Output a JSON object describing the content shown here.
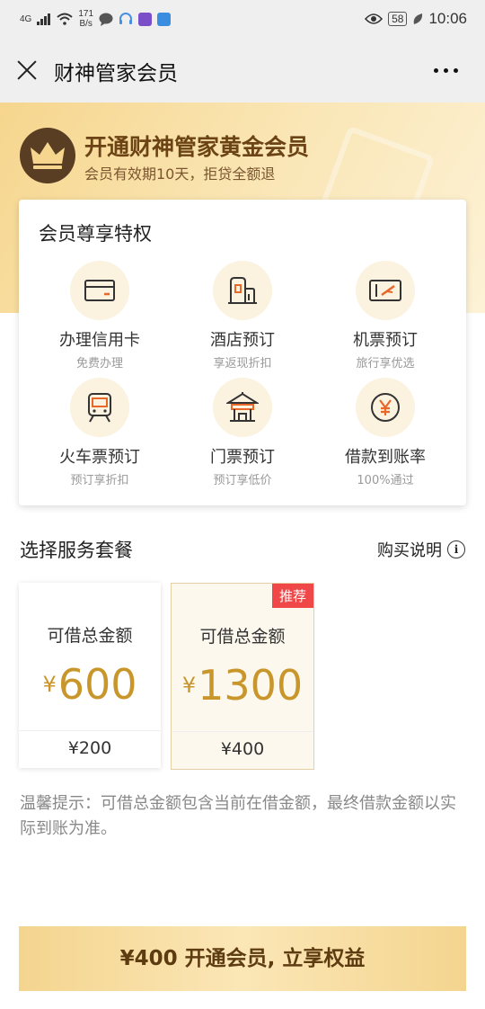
{
  "status_bar": {
    "net_type": "4G",
    "net_speed_value": "171",
    "net_speed_unit": "B/s",
    "battery": "58",
    "time": "10:06"
  },
  "header": {
    "title": "财神管家会员"
  },
  "banner": {
    "title": "开通财神管家黄金会员",
    "subtitle": "会员有效期10天，拒贷全额退"
  },
  "privileges": {
    "title": "会员尊享特权",
    "items": [
      {
        "name": "办理信用卡",
        "desc": "免费办理",
        "icon": "credit-card-icon"
      },
      {
        "name": "酒店预订",
        "desc": "享返现折扣",
        "icon": "hotel-icon"
      },
      {
        "name": "机票预订",
        "desc": "旅行享优选",
        "icon": "plane-ticket-icon"
      },
      {
        "name": "火车票预订",
        "desc": "预订享折扣",
        "icon": "train-icon"
      },
      {
        "name": "门票预订",
        "desc": "预订享低价",
        "icon": "temple-icon"
      },
      {
        "name": "借款到账率",
        "desc": "100%通过",
        "icon": "yen-icon"
      }
    ]
  },
  "packages": {
    "section_title": "选择服务套餐",
    "buy_explain": "购买说明",
    "items": [
      {
        "label": "可借总金额",
        "currency": "¥",
        "amount": "600",
        "price": "¥200",
        "badge": ""
      },
      {
        "label": "可借总金额",
        "currency": "¥",
        "amount": "1300",
        "price": "¥400",
        "badge": "推荐"
      }
    ]
  },
  "tip": "温馨提示：可借总金额包含当前在借金额，最终借款金额以实际到账为准。",
  "cta": "¥400 开通会员, 立享权益",
  "colors": {
    "gold_text": "#c9962c",
    "badge_red": "#f04848",
    "crown_bg": "#5a3e24"
  }
}
